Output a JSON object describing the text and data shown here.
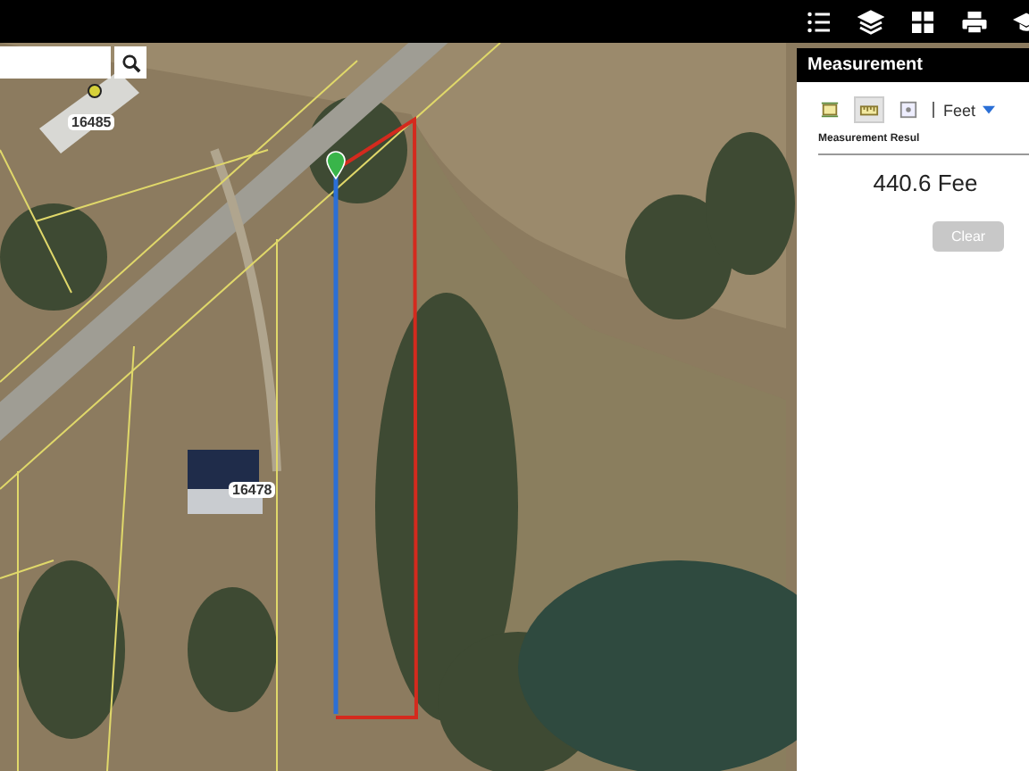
{
  "map": {
    "parcel_labels": [
      "16485",
      "16478"
    ]
  },
  "measurement_panel": {
    "title": "Measurement",
    "tools": [
      {
        "kind": "area",
        "selected": false
      },
      {
        "kind": "distance",
        "selected": true
      },
      {
        "kind": "location",
        "selected": false
      }
    ],
    "unit": "Feet",
    "result_label": "Measurement Resul",
    "result": "440.6 Fee",
    "clear_button": {
      "label": "Clear",
      "disabled": true
    }
  }
}
